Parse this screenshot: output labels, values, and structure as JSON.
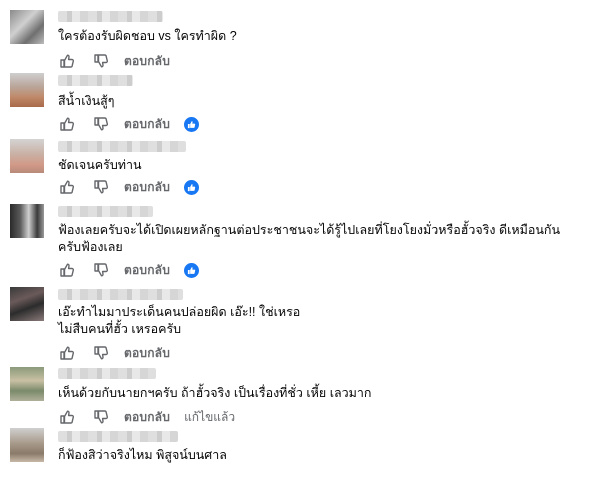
{
  "comments": [
    {
      "text_lines": [
        "ใครต้องรับผิดชอบ vs ใครทำผิด ?"
      ],
      "reply_label": "ตอบกลับ",
      "reaction": false,
      "edited": ""
    },
    {
      "text_lines": [
        "สีน้ำเงินสู้ๆ"
      ],
      "reply_label": "ตอบกลับ",
      "reaction": true,
      "edited": ""
    },
    {
      "text_lines": [
        "ชัดเจนครับท่าน"
      ],
      "reply_label": "ตอบกลับ",
      "reaction": true,
      "edited": ""
    },
    {
      "text_lines": [
        "ฟ้องเลยครับจะได้เปิดเผยหลักฐานต่อประชาชนจะได้รู้ไปเลยที่โยงโยงมั่วหรือฮั้วจริง ดีเหมือนกัน",
        "ครับฟ้องเลย"
      ],
      "reply_label": "ตอบกลับ",
      "reaction": true,
      "edited": ""
    },
    {
      "text_lines": [
        "เอ๊ะทำไมมาประเด็นคนปล่อยผิด เอ๊ะ!! ใช่เหรอ",
        "ไม่สืบคนที่ฮั้ว เหรอครับ"
      ],
      "reply_label": "ตอบกลับ",
      "reaction": false,
      "edited": ""
    },
    {
      "text_lines": [
        "เห็นด้วยกับนายกฯครับ ถ้าฮั้วจริง เป็นเรื่องที่ชั่ว เหี้ย เลวมาก"
      ],
      "reply_label": "ตอบกลับ",
      "reaction": false,
      "edited": "แก้ไขแล้ว"
    },
    {
      "text_lines": [
        "ก็ฟ้องสิว่าจริงไหม พิสูจน์บนศาล"
      ],
      "reply_label": "",
      "reaction": false,
      "edited": ""
    }
  ],
  "colors": {
    "reaction_blue": "#1877f2",
    "meta_gray": "#65676b",
    "text": "#050505"
  },
  "icons": {
    "like": "thumbs-up-outline-icon",
    "dislike": "thumbs-down-outline-icon",
    "reaction": "like-reaction-icon"
  }
}
